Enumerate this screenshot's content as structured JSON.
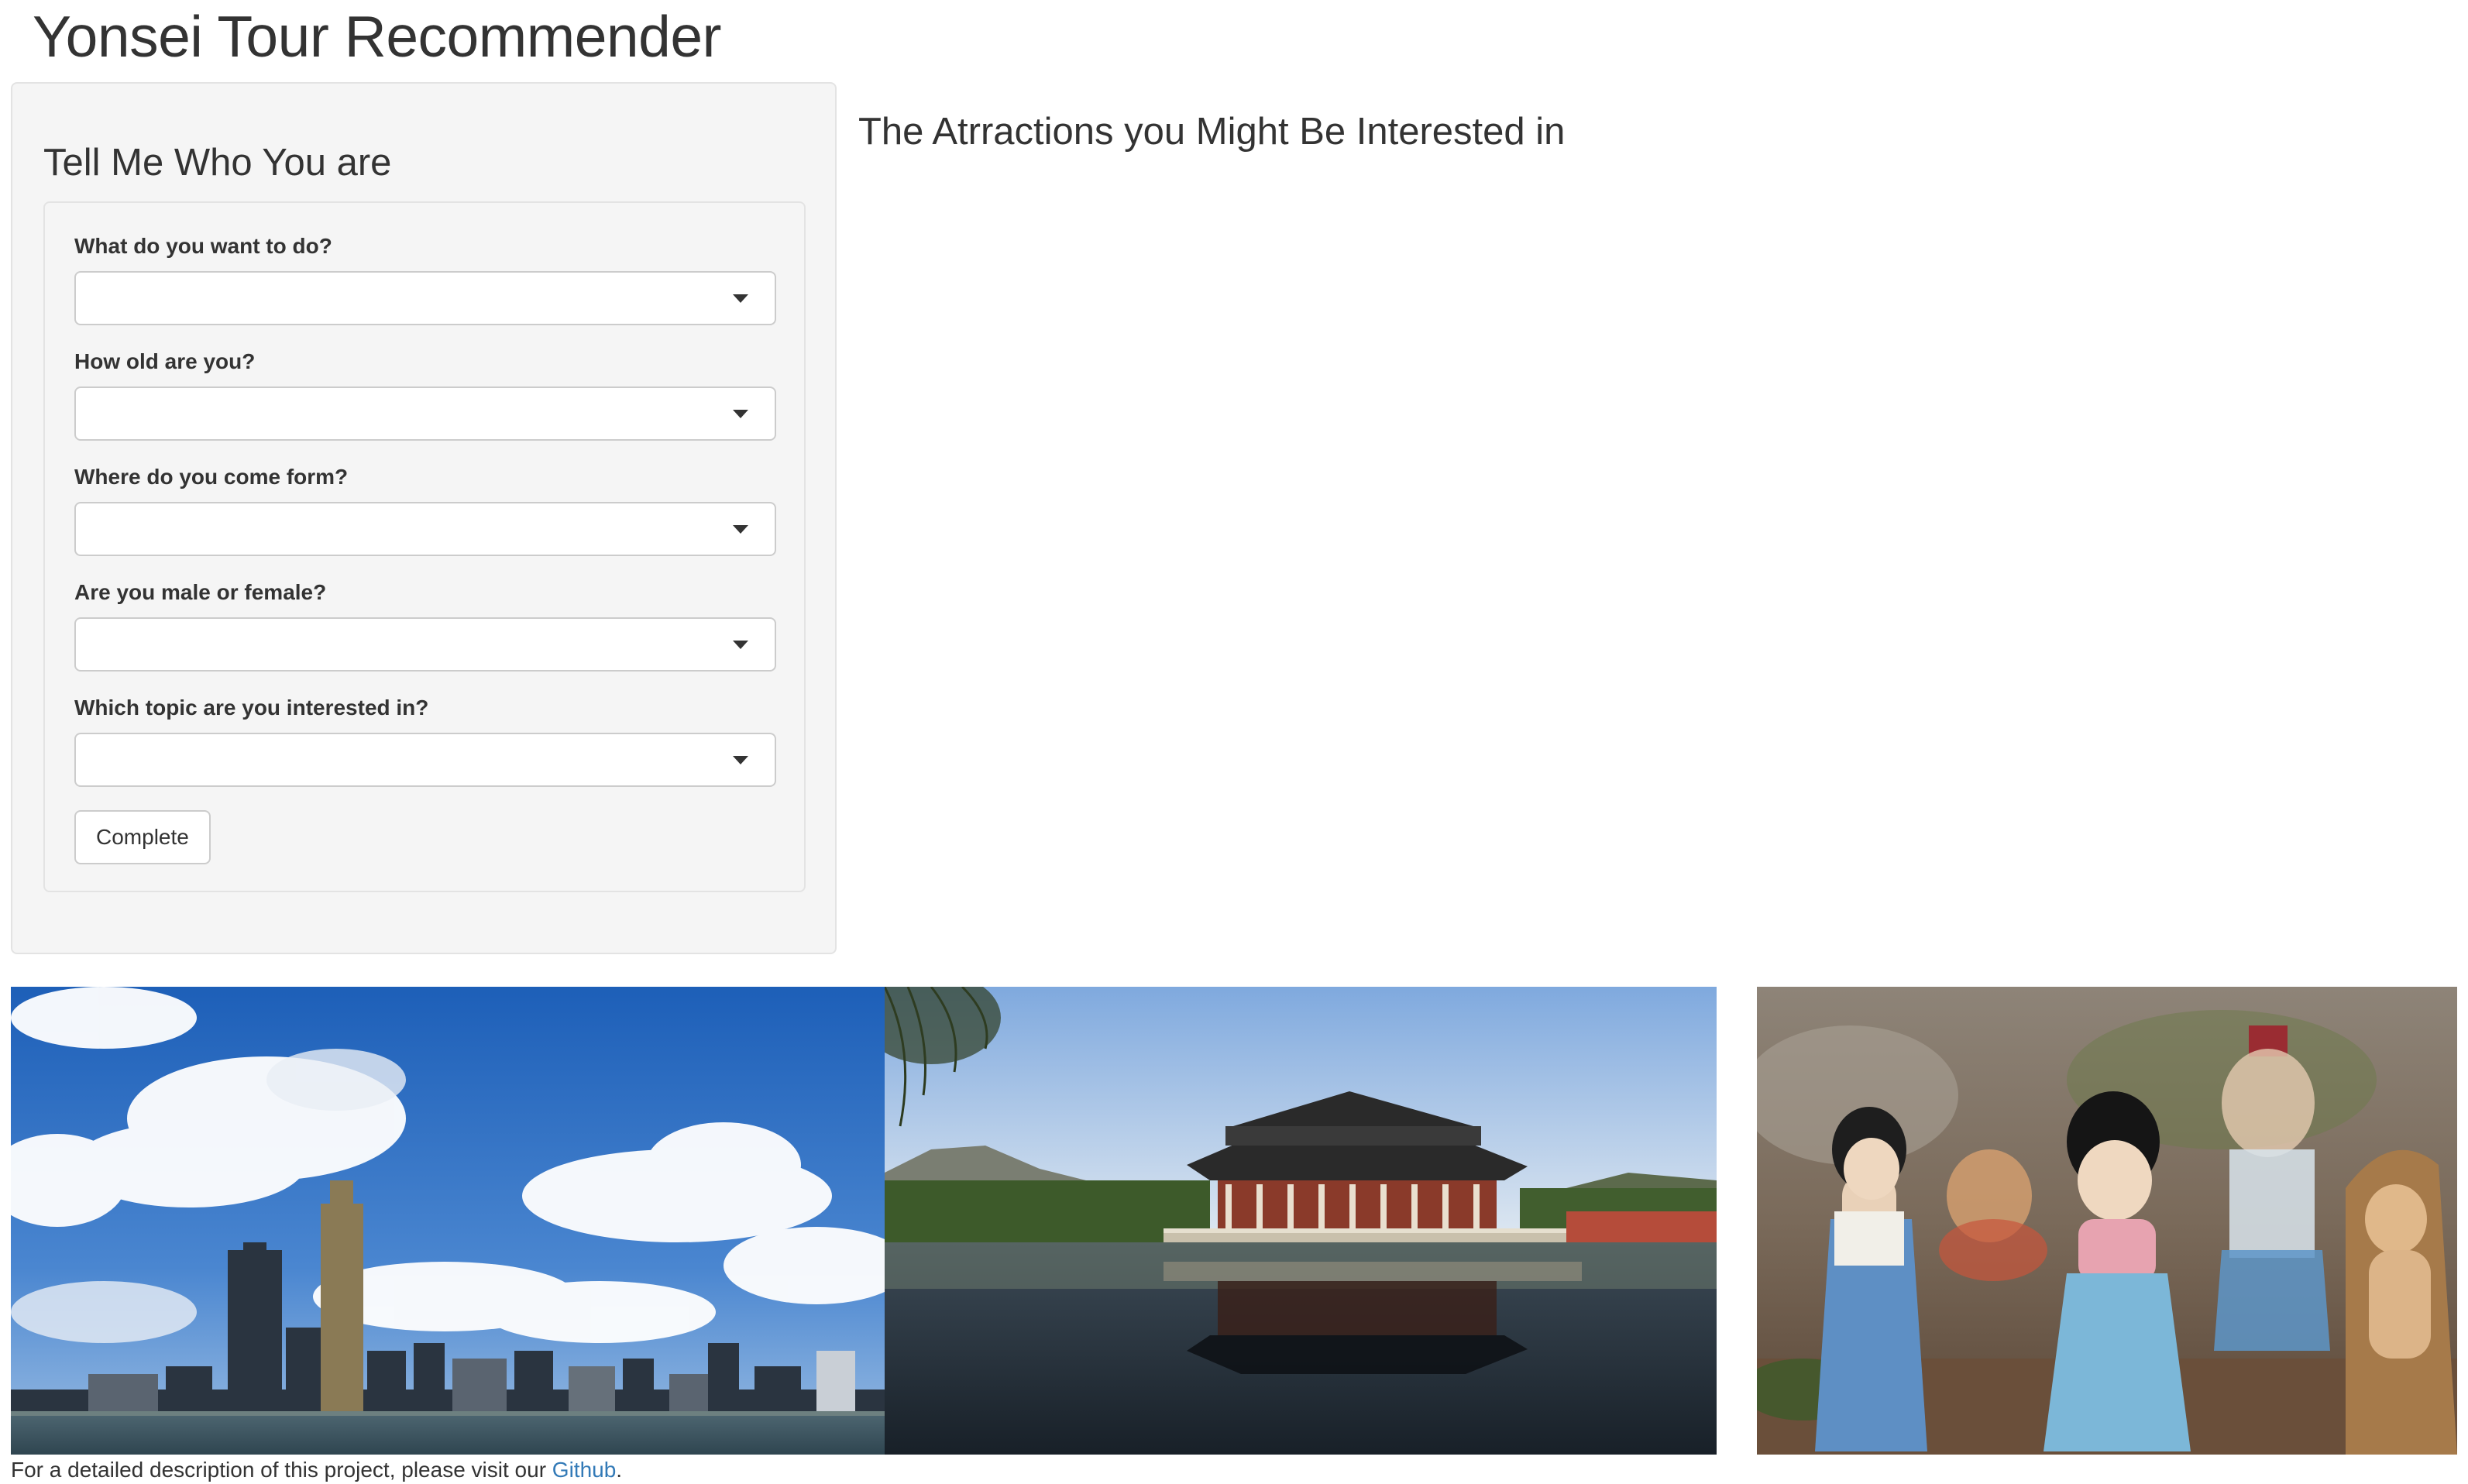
{
  "app": {
    "title": "Yonsei Tour Recommender"
  },
  "sidebar": {
    "heading": "Tell Me Who You are",
    "fields": [
      {
        "label": "What do you want to do?",
        "value": ""
      },
      {
        "label": "How old are you?",
        "value": ""
      },
      {
        "label": "Where do you come form?",
        "value": ""
      },
      {
        "label": "Are you male or female?",
        "value": ""
      },
      {
        "label": "Which topic are you interested in?",
        "value": ""
      }
    ],
    "submit_label": "Complete"
  },
  "main": {
    "heading": "The Atrractions you Might Be Interested in"
  },
  "photos": [
    {
      "name": "seoul-skyline-han-river-photo"
    },
    {
      "name": "gyeonghoeru-pavilion-photo"
    },
    {
      "name": "hanbok-figurines-photo"
    }
  ],
  "footer": {
    "text": "For a detailed description of this project, please visit our ",
    "link_label": "Github",
    "suffix": "."
  },
  "colors": {
    "link": "#337ab7",
    "panel_bg": "#f5f5f5",
    "border": "#e3e3e3"
  }
}
